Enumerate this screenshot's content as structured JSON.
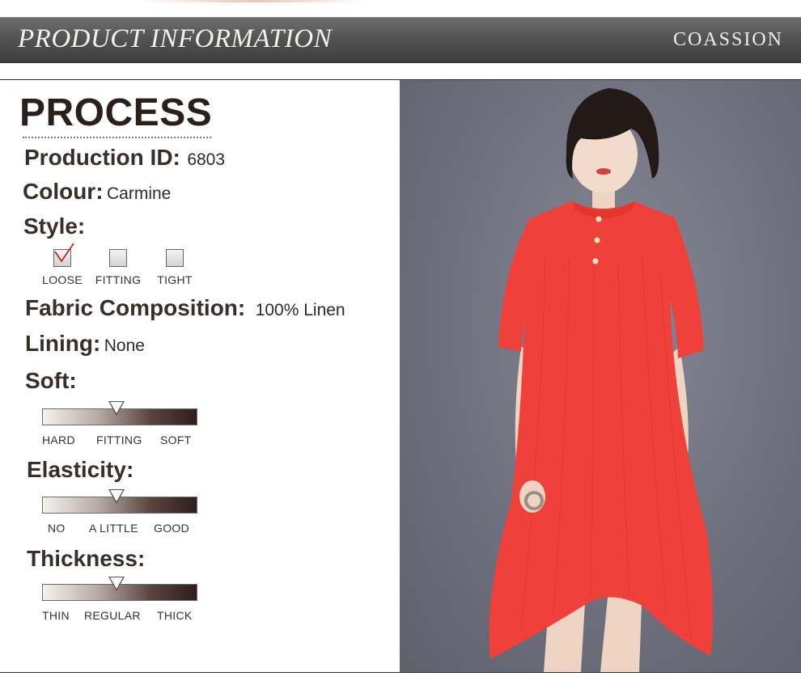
{
  "header": {
    "title": "PRODUCT INFORMATION",
    "brand": "COASSION"
  },
  "process": {
    "title": "PROCESS",
    "production_id_label": "Production ID:",
    "production_id": "6803",
    "colour_label": "Colour:",
    "colour": "Carmine",
    "style_label": "Style:",
    "style_options": [
      {
        "label": "LOOSE",
        "checked": true
      },
      {
        "label": "FITTING",
        "checked": false
      },
      {
        "label": "TIGHT",
        "checked": false
      }
    ],
    "fabric_label": "Fabric Composition:",
    "fabric": "100% Linen",
    "lining_label": "Lining:",
    "lining": "None"
  },
  "scales": {
    "soft": {
      "label": "Soft:",
      "options": [
        "HARD",
        "FITTING",
        "SOFT"
      ],
      "level": 0.48
    },
    "elasticity": {
      "label": "Elasticity:",
      "options": [
        "NO",
        "A LITTLE",
        "GOOD"
      ],
      "level": 0.48
    },
    "thickness": {
      "label": "Thickness:",
      "options": [
        "THIN",
        "REGULAR",
        "THICK"
      ],
      "level": 0.48
    }
  },
  "colors": {
    "header": "#545454",
    "dress": "#f0403a",
    "photo_background": "#767783",
    "check": "#c8241c"
  },
  "icons": {
    "style_check": "check-mark-icon",
    "scale_marker": "triangle-down-icon"
  }
}
